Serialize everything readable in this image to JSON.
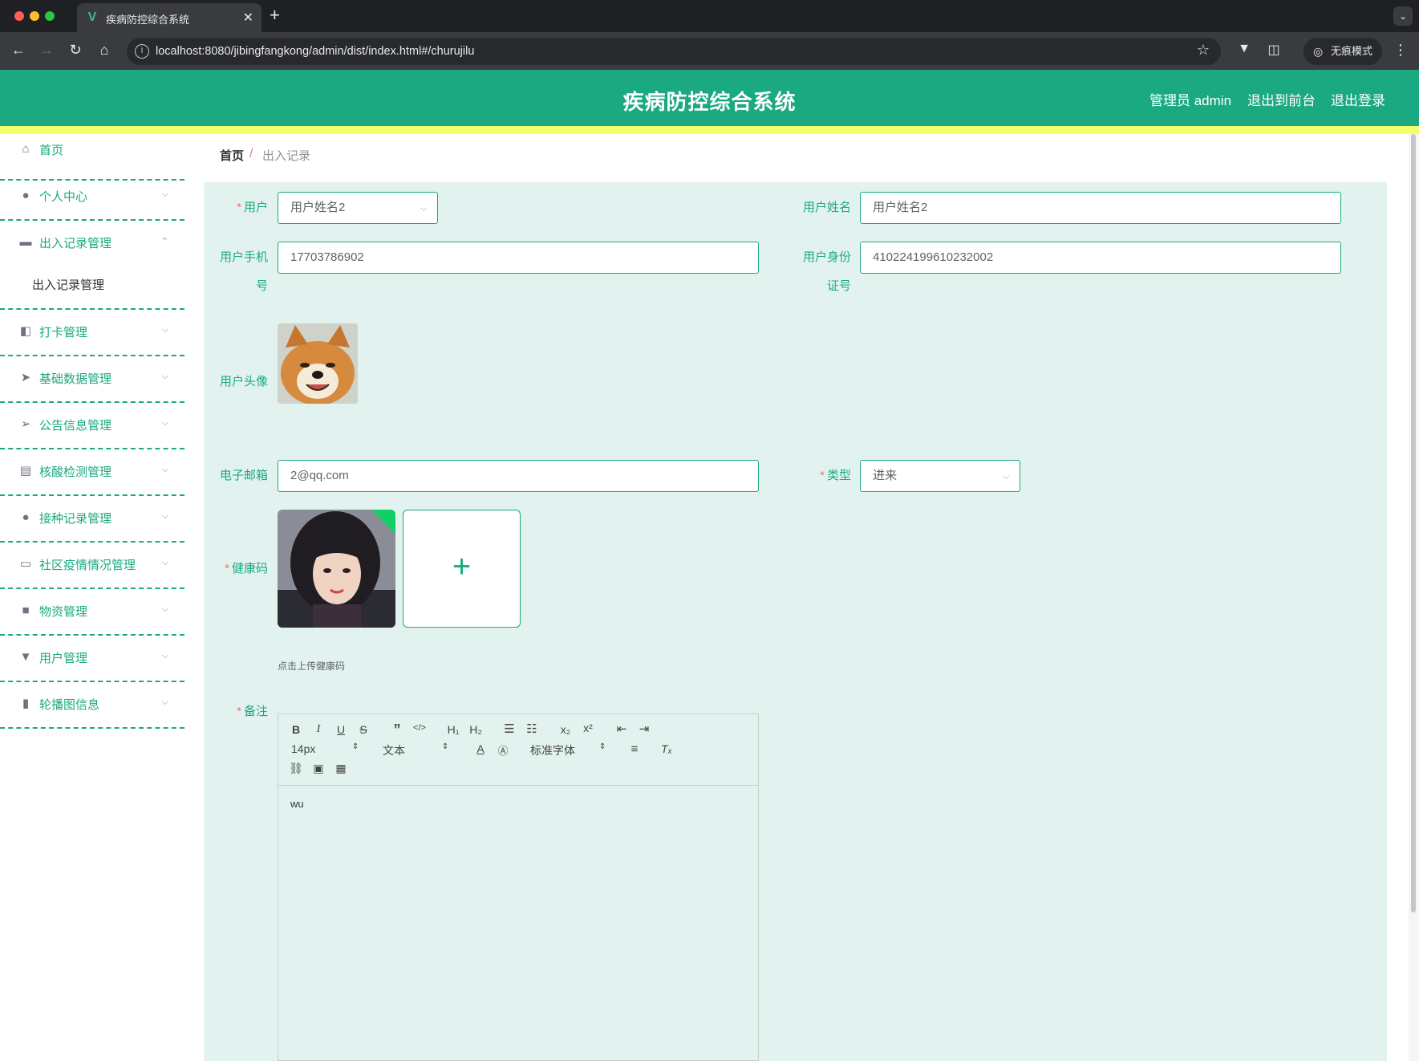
{
  "browser": {
    "tab_title": "疾病防控综合系统",
    "url": "localhost:8080/jibingfangkong/admin/dist/index.html#/churujilu",
    "incognito_label": "无痕模式"
  },
  "header": {
    "title": "疾病防控综合系统",
    "user_label": "管理员 admin",
    "front_link": "退出到前台",
    "logout_link": "退出登录"
  },
  "sidebar": {
    "items": [
      {
        "label": "首页",
        "icon": "home-icon"
      },
      {
        "label": "个人中心",
        "icon": "user-icon"
      },
      {
        "label": "出入记录管理",
        "icon": "record-icon"
      },
      {
        "label": "打卡管理",
        "icon": "checkin-icon"
      },
      {
        "label": "基础数据管理",
        "icon": "send-icon"
      },
      {
        "label": "公告信息管理",
        "icon": "navigation-icon"
      },
      {
        "label": "核酸检测管理",
        "icon": "briefcase-icon"
      },
      {
        "label": "接种记录管理",
        "icon": "user-icon"
      },
      {
        "label": "社区疫情情况管理",
        "icon": "chat-icon"
      },
      {
        "label": "物资管理",
        "icon": "message-icon"
      },
      {
        "label": "用户管理",
        "icon": "stamp-icon"
      },
      {
        "label": "轮播图信息",
        "icon": "chart-icon"
      }
    ],
    "submenu_label": "出入记录管理"
  },
  "breadcrumb": {
    "home": "首页",
    "separator": "/",
    "current": "出入记录"
  },
  "form": {
    "user_label": "用户",
    "user_value": "用户姓名2",
    "username_label": "用户姓名",
    "username_value": "用户姓名2",
    "phone_label_1": "用户手机",
    "phone_label_2": "号",
    "phone_value": "17703786902",
    "idcard_label_1": "用户身份",
    "idcard_label_2": "证号",
    "idcard_value": "410224199610232002",
    "avatar_label": "用户头像",
    "email_label": "电子邮箱",
    "email_value": "2@qq.com",
    "type_label": "类型",
    "type_value": "进来",
    "health_label": "健康码",
    "upload_hint": "点击上传健康码",
    "remark_label": "备注",
    "remark_value": "wu"
  },
  "editor": {
    "font_size": "14px",
    "header_select": "文本",
    "font_family": "标准字体"
  },
  "colors": {
    "primary": "#1aa980",
    "stripe": "#f5ff6b",
    "panel": "#e2f3ef",
    "required": "#f56c6c"
  }
}
